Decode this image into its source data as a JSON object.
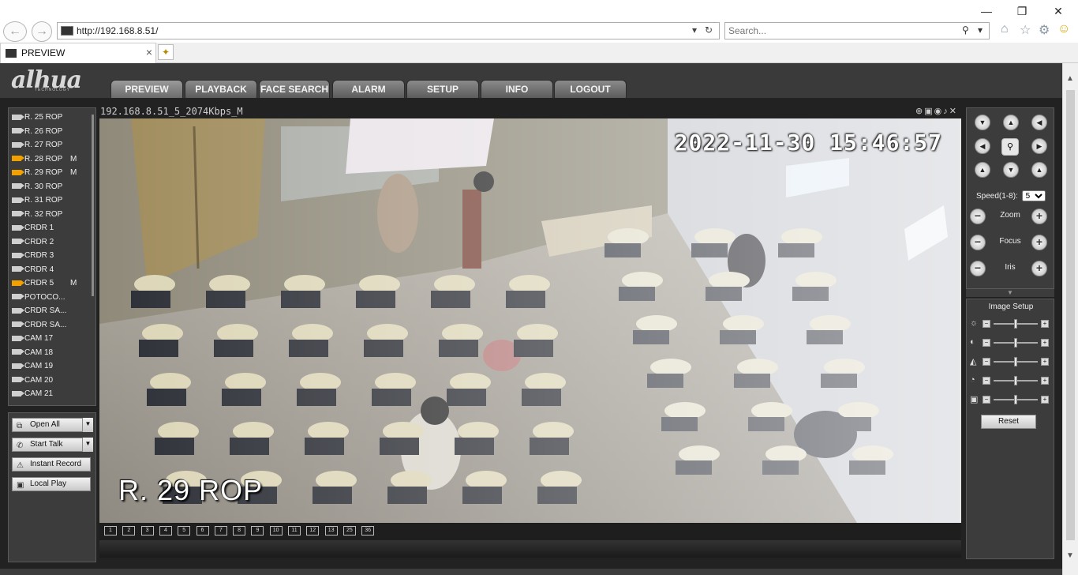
{
  "browser": {
    "address": "http://192.168.8.51/",
    "search_placeholder": "Search...",
    "tab_title": "PREVIEW"
  },
  "app": {
    "logo": "alhua",
    "logo_sub": "TECHNOLOGY",
    "nav": [
      "PREVIEW",
      "PLAYBACK",
      "FACE SEARCH",
      "ALARM",
      "SETUP",
      "INFO",
      "LOGOUT"
    ],
    "active_tab": "PREVIEW",
    "channels": [
      {
        "name": "R. 25 ROP",
        "active": false,
        "flag": ""
      },
      {
        "name": "R. 26 ROP",
        "active": false,
        "flag": ""
      },
      {
        "name": "R. 27 ROP",
        "active": false,
        "flag": ""
      },
      {
        "name": "R. 28 ROP",
        "active": true,
        "flag": "M"
      },
      {
        "name": "R. 29 ROP",
        "active": true,
        "flag": "M"
      },
      {
        "name": "R. 30 ROP",
        "active": false,
        "flag": ""
      },
      {
        "name": "R. 31 ROP",
        "active": false,
        "flag": ""
      },
      {
        "name": "R. 32 ROP",
        "active": false,
        "flag": ""
      },
      {
        "name": "CRDR 1",
        "active": false,
        "flag": ""
      },
      {
        "name": "CRDR 2",
        "active": false,
        "flag": ""
      },
      {
        "name": "CRDR 3",
        "active": false,
        "flag": ""
      },
      {
        "name": "CRDR 4",
        "active": false,
        "flag": ""
      },
      {
        "name": "CRDR 5",
        "active": true,
        "flag": "M"
      },
      {
        "name": "POTOCO...",
        "active": false,
        "flag": ""
      },
      {
        "name": "CRDR SA...",
        "active": false,
        "flag": ""
      },
      {
        "name": "CRDR SA...",
        "active": false,
        "flag": ""
      },
      {
        "name": "CAM 17",
        "active": false,
        "flag": ""
      },
      {
        "name": "CAM 18",
        "active": false,
        "flag": ""
      },
      {
        "name": "CAM 19",
        "active": false,
        "flag": ""
      },
      {
        "name": "CAM 20",
        "active": false,
        "flag": ""
      },
      {
        "name": "CAM 21",
        "active": false,
        "flag": ""
      }
    ],
    "controls": {
      "open_all": "Open All",
      "start_talk": "Start Talk",
      "instant_record": "Instant Record",
      "local_play": "Local Play"
    },
    "video": {
      "stream_title": "192.168.8.51_5_2074Kbps_M",
      "osd_datetime": "2022-11-30  15:46:57",
      "osd_channel": "R. 29 ROP"
    },
    "layouts": [
      "1",
      "2",
      "3",
      "4",
      "5",
      "6",
      "7",
      "8",
      "9",
      "10",
      "11",
      "12",
      "13",
      "25",
      "36"
    ],
    "ptz": {
      "speed_label": "Speed(1-8):",
      "speed_value": "5",
      "zoom": "Zoom",
      "focus": "Focus",
      "iris": "Iris"
    },
    "image_setup": {
      "title": "Image Setup",
      "reset": "Reset",
      "levels": [
        0.5,
        0.5,
        0.5,
        0.5,
        0.5
      ]
    }
  }
}
